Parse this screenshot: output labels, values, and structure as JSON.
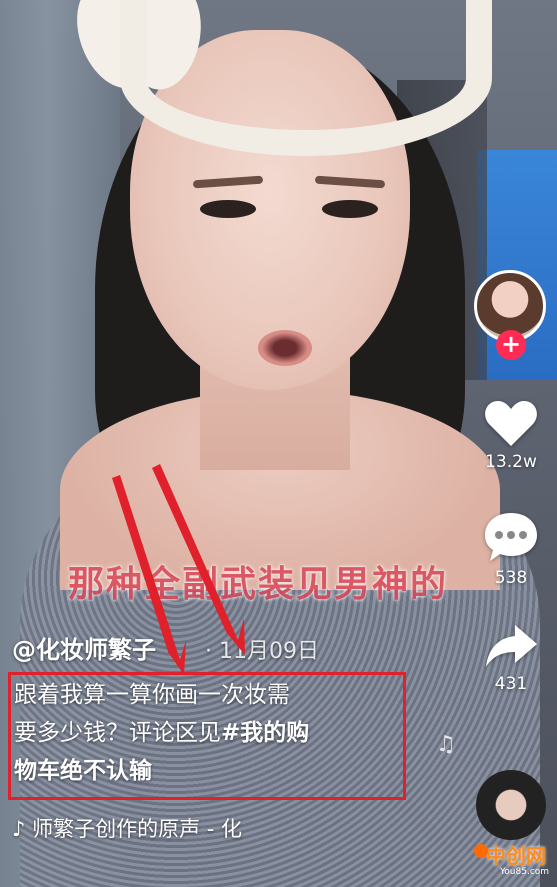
{
  "video": {
    "overlay_caption": "那种全副武装见男神的"
  },
  "author": {
    "handle": "@化妆师繁子",
    "date": "· 11月09日"
  },
  "description": {
    "line1": "跟着我算一算你画一次妆需",
    "line2_plain": "要多少钱？评论区见",
    "line2_tag": "#我的购",
    "line3_tag": "物车绝不认输"
  },
  "music": {
    "icon": "music-note-icon",
    "text": "♪ 师繁子创作的原声 - 化"
  },
  "rail": {
    "follow_label": "+",
    "like_count": "13.2w",
    "comment_count": "538",
    "share_count": "431"
  },
  "watermark": {
    "main": "中创网",
    "sub": "You85.com"
  },
  "colors": {
    "highlight_box": "#e0202a",
    "follow": "#fe2c55",
    "caption": "#d9495a"
  }
}
